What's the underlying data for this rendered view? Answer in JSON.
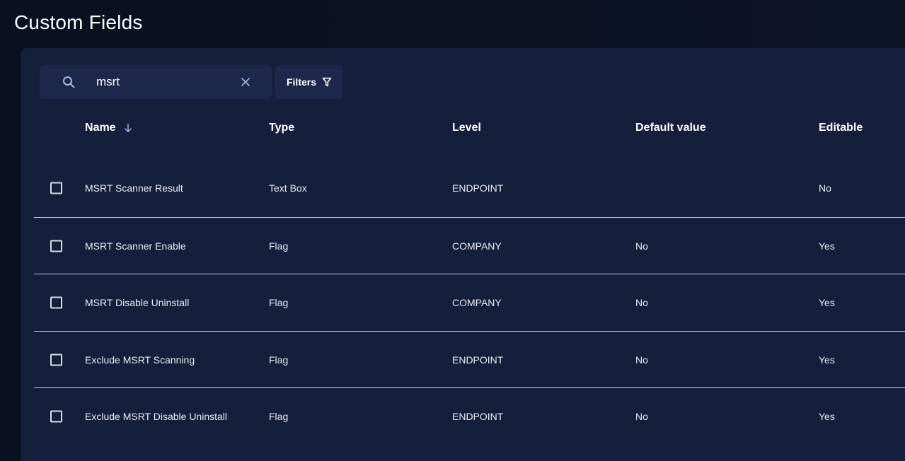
{
  "page": {
    "title": "Custom Fields"
  },
  "search": {
    "value": "msrt",
    "placeholder": "Search",
    "icon": "search-icon",
    "clear_icon": "close-icon"
  },
  "filters": {
    "label": "Filters",
    "icon": "filter-icon"
  },
  "table": {
    "columns": [
      {
        "label": "Name",
        "sorted": "descending"
      },
      {
        "label": "Type"
      },
      {
        "label": "Level"
      },
      {
        "label": "Default value"
      },
      {
        "label": "Editable"
      }
    ],
    "rows": [
      {
        "name": "MSRT Scanner Result",
        "type": "Text Box",
        "level": "ENDPOINT",
        "default_value": "",
        "editable": "No"
      },
      {
        "name": "MSRT Scanner Enable",
        "type": "Flag",
        "level": "COMPANY",
        "default_value": "No",
        "editable": "Yes"
      },
      {
        "name": "MSRT Disable Uninstall",
        "type": "Flag",
        "level": "COMPANY",
        "default_value": "No",
        "editable": "Yes"
      },
      {
        "name": "Exclude MSRT Scanning",
        "type": "Flag",
        "level": "ENDPOINT",
        "default_value": "No",
        "editable": "Yes"
      },
      {
        "name": "Exclude MSRT Disable Uninstall",
        "type": "Flag",
        "level": "ENDPOINT",
        "default_value": "No",
        "editable": "Yes"
      }
    ]
  },
  "colors": {
    "background": "#0c1124",
    "panel": "#141f3c",
    "control": "#1c2849",
    "divider": "#c8cdd8",
    "text": "#ffffff"
  }
}
